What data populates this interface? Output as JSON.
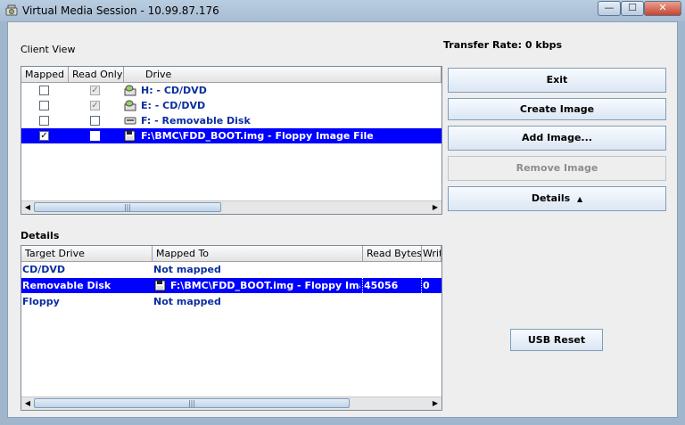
{
  "window": {
    "title": "Virtual Media Session - 10.99.87.176",
    "min": "—",
    "max": "☐",
    "close": "✕"
  },
  "client_view": {
    "label": "Client View",
    "transfer_label": "Transfer Rate:",
    "transfer_value": "0 kbps",
    "columns": [
      "Mapped",
      "Read Only",
      "Drive"
    ],
    "rows": [
      {
        "mapped": false,
        "read_only": true,
        "icon": "cd-drive-icon",
        "drive": "H: - CD/DVD",
        "selected": false
      },
      {
        "mapped": false,
        "read_only": true,
        "icon": "cd-drive-icon",
        "drive": "E: - CD/DVD",
        "selected": false
      },
      {
        "mapped": false,
        "read_only": false,
        "icon": "removable-disk-icon",
        "drive": "F: - Removable Disk",
        "selected": false
      },
      {
        "mapped": true,
        "read_only": false,
        "icon": "floppy-image-icon",
        "drive": "F:\\BMC\\FDD_BOOT.img - Floppy Image File",
        "selected": true
      }
    ]
  },
  "buttons": {
    "exit": "Exit",
    "create_image": "Create Image",
    "add_image": "Add Image...",
    "remove_image": "Remove Image",
    "details": "Details",
    "details_arrow": "▲",
    "usb_reset": "USB Reset"
  },
  "details": {
    "label": "Details",
    "columns": [
      "Target Drive",
      "Mapped To",
      "Read Bytes",
      "Writ"
    ],
    "rows": [
      {
        "target": "CD/DVD",
        "mapped_to": "Not mapped",
        "read_bytes": "",
        "write_bytes": "",
        "selected": false,
        "icon": ""
      },
      {
        "target": "Removable Disk",
        "mapped_to": "F:\\BMC\\FDD_BOOT.img - Floppy Image File",
        "read_bytes": "45056",
        "write_bytes": "0",
        "selected": true,
        "icon": "floppy-image-icon"
      },
      {
        "target": "Floppy",
        "mapped_to": "Not mapped",
        "read_bytes": "",
        "write_bytes": "",
        "selected": false,
        "icon": ""
      }
    ]
  },
  "scroll": {
    "left_arrow": "◀",
    "right_arrow": "▶",
    "grip": "|||"
  }
}
